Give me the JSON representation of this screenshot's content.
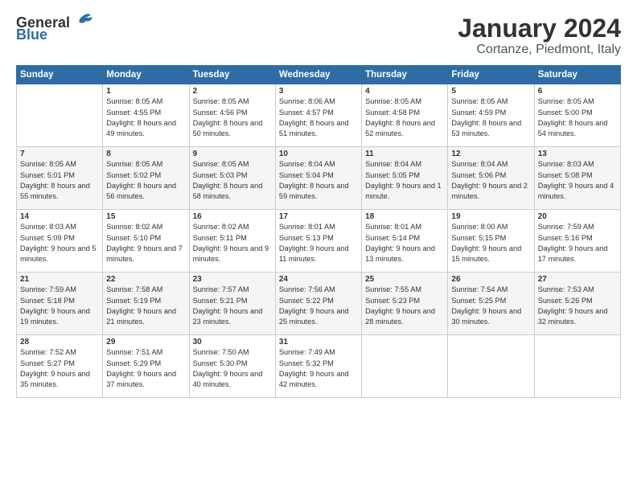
{
  "logo": {
    "general": "General",
    "blue": "Blue"
  },
  "header": {
    "month": "January 2024",
    "location": "Cortanze, Piedmont, Italy"
  },
  "weekdays": [
    "Sunday",
    "Monday",
    "Tuesday",
    "Wednesday",
    "Thursday",
    "Friday",
    "Saturday"
  ],
  "weeks": [
    [
      {
        "day": "",
        "sunrise": "",
        "sunset": "",
        "daylight": ""
      },
      {
        "day": "1",
        "sunrise": "Sunrise: 8:05 AM",
        "sunset": "Sunset: 4:55 PM",
        "daylight": "Daylight: 8 hours and 49 minutes."
      },
      {
        "day": "2",
        "sunrise": "Sunrise: 8:05 AM",
        "sunset": "Sunset: 4:56 PM",
        "daylight": "Daylight: 8 hours and 50 minutes."
      },
      {
        "day": "3",
        "sunrise": "Sunrise: 8:06 AM",
        "sunset": "Sunset: 4:57 PM",
        "daylight": "Daylight: 8 hours and 51 minutes."
      },
      {
        "day": "4",
        "sunrise": "Sunrise: 8:05 AM",
        "sunset": "Sunset: 4:58 PM",
        "daylight": "Daylight: 8 hours and 52 minutes."
      },
      {
        "day": "5",
        "sunrise": "Sunrise: 8:05 AM",
        "sunset": "Sunset: 4:59 PM",
        "daylight": "Daylight: 8 hours and 53 minutes."
      },
      {
        "day": "6",
        "sunrise": "Sunrise: 8:05 AM",
        "sunset": "Sunset: 5:00 PM",
        "daylight": "Daylight: 8 hours and 54 minutes."
      }
    ],
    [
      {
        "day": "7",
        "sunrise": "Sunrise: 8:05 AM",
        "sunset": "Sunset: 5:01 PM",
        "daylight": "Daylight: 8 hours and 55 minutes."
      },
      {
        "day": "8",
        "sunrise": "Sunrise: 8:05 AM",
        "sunset": "Sunset: 5:02 PM",
        "daylight": "Daylight: 8 hours and 56 minutes."
      },
      {
        "day": "9",
        "sunrise": "Sunrise: 8:05 AM",
        "sunset": "Sunset: 5:03 PM",
        "daylight": "Daylight: 8 hours and 58 minutes."
      },
      {
        "day": "10",
        "sunrise": "Sunrise: 8:04 AM",
        "sunset": "Sunset: 5:04 PM",
        "daylight": "Daylight: 8 hours and 59 minutes."
      },
      {
        "day": "11",
        "sunrise": "Sunrise: 8:04 AM",
        "sunset": "Sunset: 5:05 PM",
        "daylight": "Daylight: 9 hours and 1 minute."
      },
      {
        "day": "12",
        "sunrise": "Sunrise: 8:04 AM",
        "sunset": "Sunset: 5:06 PM",
        "daylight": "Daylight: 9 hours and 2 minutes."
      },
      {
        "day": "13",
        "sunrise": "Sunrise: 8:03 AM",
        "sunset": "Sunset: 5:08 PM",
        "daylight": "Daylight: 9 hours and 4 minutes."
      }
    ],
    [
      {
        "day": "14",
        "sunrise": "Sunrise: 8:03 AM",
        "sunset": "Sunset: 5:09 PM",
        "daylight": "Daylight: 9 hours and 5 minutes."
      },
      {
        "day": "15",
        "sunrise": "Sunrise: 8:02 AM",
        "sunset": "Sunset: 5:10 PM",
        "daylight": "Daylight: 9 hours and 7 minutes."
      },
      {
        "day": "16",
        "sunrise": "Sunrise: 8:02 AM",
        "sunset": "Sunset: 5:11 PM",
        "daylight": "Daylight: 9 hours and 9 minutes."
      },
      {
        "day": "17",
        "sunrise": "Sunrise: 8:01 AM",
        "sunset": "Sunset: 5:13 PM",
        "daylight": "Daylight: 9 hours and 11 minutes."
      },
      {
        "day": "18",
        "sunrise": "Sunrise: 8:01 AM",
        "sunset": "Sunset: 5:14 PM",
        "daylight": "Daylight: 9 hours and 13 minutes."
      },
      {
        "day": "19",
        "sunrise": "Sunrise: 8:00 AM",
        "sunset": "Sunset: 5:15 PM",
        "daylight": "Daylight: 9 hours and 15 minutes."
      },
      {
        "day": "20",
        "sunrise": "Sunrise: 7:59 AM",
        "sunset": "Sunset: 5:16 PM",
        "daylight": "Daylight: 9 hours and 17 minutes."
      }
    ],
    [
      {
        "day": "21",
        "sunrise": "Sunrise: 7:59 AM",
        "sunset": "Sunset: 5:18 PM",
        "daylight": "Daylight: 9 hours and 19 minutes."
      },
      {
        "day": "22",
        "sunrise": "Sunrise: 7:58 AM",
        "sunset": "Sunset: 5:19 PM",
        "daylight": "Daylight: 9 hours and 21 minutes."
      },
      {
        "day": "23",
        "sunrise": "Sunrise: 7:57 AM",
        "sunset": "Sunset: 5:21 PM",
        "daylight": "Daylight: 9 hours and 23 minutes."
      },
      {
        "day": "24",
        "sunrise": "Sunrise: 7:56 AM",
        "sunset": "Sunset: 5:22 PM",
        "daylight": "Daylight: 9 hours and 25 minutes."
      },
      {
        "day": "25",
        "sunrise": "Sunrise: 7:55 AM",
        "sunset": "Sunset: 5:23 PM",
        "daylight": "Daylight: 9 hours and 28 minutes."
      },
      {
        "day": "26",
        "sunrise": "Sunrise: 7:54 AM",
        "sunset": "Sunset: 5:25 PM",
        "daylight": "Daylight: 9 hours and 30 minutes."
      },
      {
        "day": "27",
        "sunrise": "Sunrise: 7:53 AM",
        "sunset": "Sunset: 5:26 PM",
        "daylight": "Daylight: 9 hours and 32 minutes."
      }
    ],
    [
      {
        "day": "28",
        "sunrise": "Sunrise: 7:52 AM",
        "sunset": "Sunset: 5:27 PM",
        "daylight": "Daylight: 9 hours and 35 minutes."
      },
      {
        "day": "29",
        "sunrise": "Sunrise: 7:51 AM",
        "sunset": "Sunset: 5:29 PM",
        "daylight": "Daylight: 9 hours and 37 minutes."
      },
      {
        "day": "30",
        "sunrise": "Sunrise: 7:50 AM",
        "sunset": "Sunset: 5:30 PM",
        "daylight": "Daylight: 9 hours and 40 minutes."
      },
      {
        "day": "31",
        "sunrise": "Sunrise: 7:49 AM",
        "sunset": "Sunset: 5:32 PM",
        "daylight": "Daylight: 9 hours and 42 minutes."
      },
      {
        "day": "",
        "sunrise": "",
        "sunset": "",
        "daylight": ""
      },
      {
        "day": "",
        "sunrise": "",
        "sunset": "",
        "daylight": ""
      },
      {
        "day": "",
        "sunrise": "",
        "sunset": "",
        "daylight": ""
      }
    ]
  ]
}
